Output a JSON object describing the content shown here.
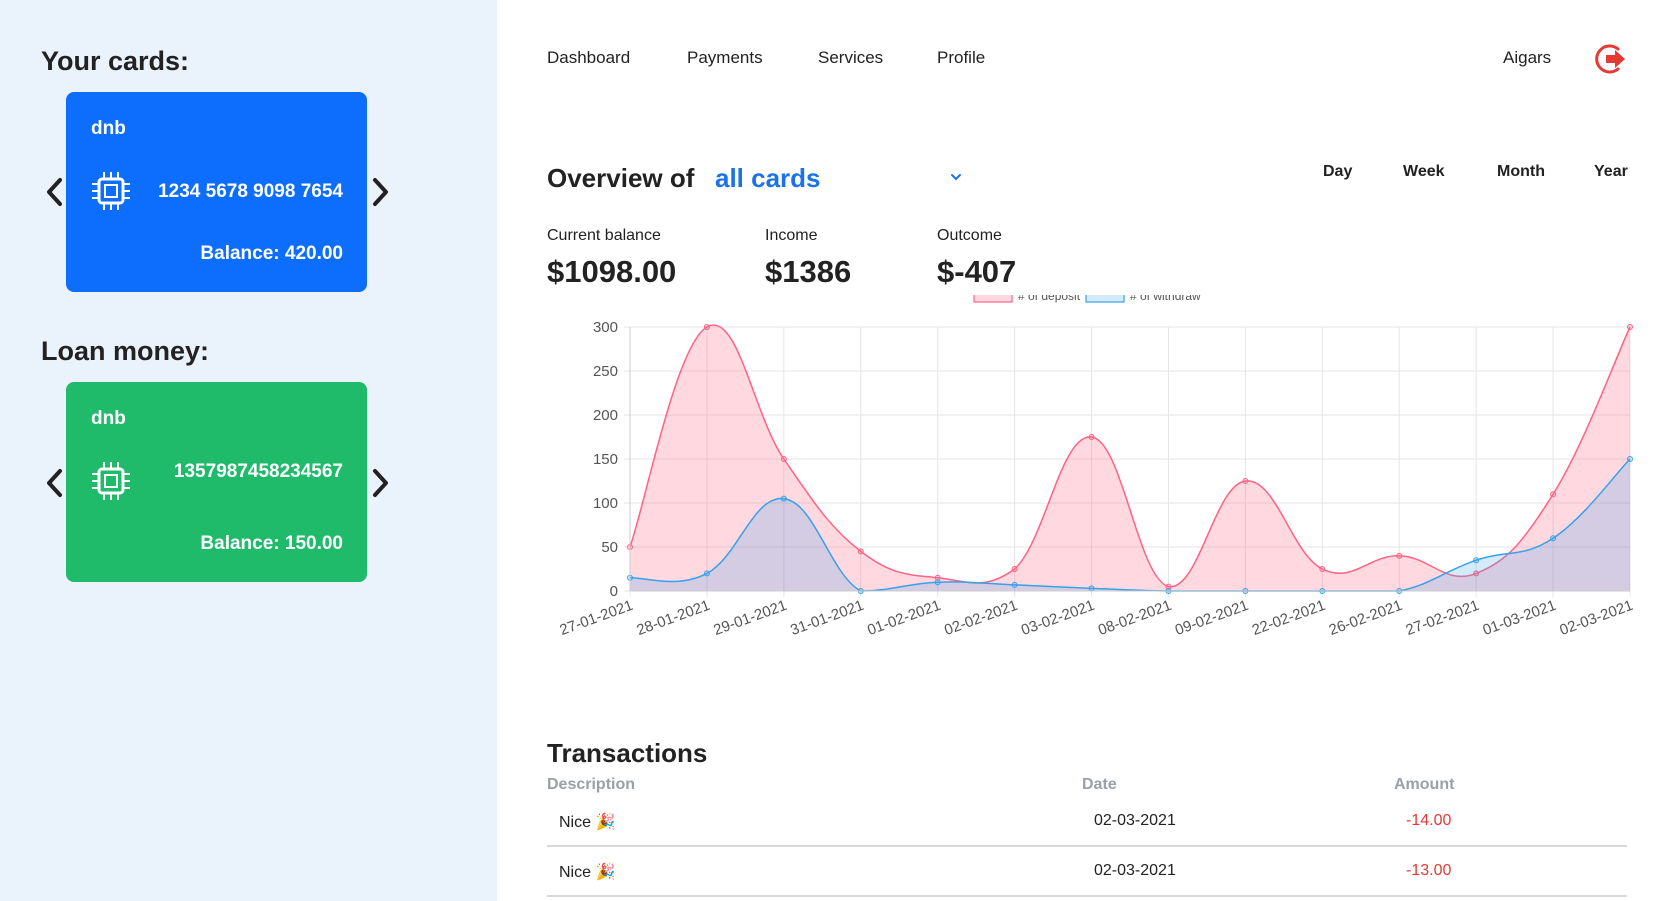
{
  "sidebar": {
    "cards_title": "Your cards:",
    "loan_title": "Loan money:",
    "cards": [
      {
        "bank": "dnb",
        "number": "1234 5678 9098 7654",
        "balance": "Balance: 420.00",
        "color": "#0d6efd"
      },
      {
        "bank": "dnb",
        "number": "1357987458234567",
        "balance": "Balance: 150.00",
        "color": "#1fbb6b"
      }
    ]
  },
  "nav": {
    "items": [
      "Dashboard",
      "Payments",
      "Services",
      "Profile"
    ],
    "user": "Aigars",
    "logout_icon": "logout-icon",
    "accent": "#e53935"
  },
  "overview": {
    "title": "Overview of",
    "selected": "all cards",
    "periods": [
      "Day",
      "Week",
      "Month",
      "Year"
    ]
  },
  "stats": [
    {
      "label": "Current balance",
      "value": "$1098.00"
    },
    {
      "label": "Income",
      "value": "$1386"
    },
    {
      "label": "Outcome",
      "value": "$-407"
    }
  ],
  "chart_data": {
    "type": "area",
    "x": [
      "27-01-2021",
      "28-01-2021",
      "29-01-2021",
      "31-01-2021",
      "01-02-2021",
      "02-02-2021",
      "03-02-2021",
      "08-02-2021",
      "09-02-2021",
      "22-02-2021",
      "26-02-2021",
      "27-02-2021",
      "01-03-2021",
      "02-03-2021"
    ],
    "ylim": [
      0,
      300
    ],
    "yticks": [
      0,
      50,
      100,
      150,
      200,
      250,
      300
    ],
    "series": [
      {
        "name": "# of deposit",
        "values": [
          50,
          300,
          150,
          45,
          15,
          25,
          175,
          5,
          125,
          25,
          40,
          20,
          110,
          300
        ],
        "color": "#ff6384"
      },
      {
        "name": "# of withdraw",
        "values": [
          15,
          20,
          105,
          0,
          10,
          7,
          3,
          0,
          0,
          0,
          0,
          35,
          60,
          150
        ],
        "color": "#36a2eb"
      }
    ],
    "grid": true,
    "legend": "top"
  },
  "transactions": {
    "title": "Transactions",
    "columns": [
      "Description",
      "Date",
      "Amount"
    ],
    "rows": [
      {
        "description": "Nice 🎉",
        "date": "02-03-2021",
        "amount": "-14.00"
      },
      {
        "description": "Nice 🎉",
        "date": "02-03-2021",
        "amount": "-13.00"
      }
    ]
  }
}
